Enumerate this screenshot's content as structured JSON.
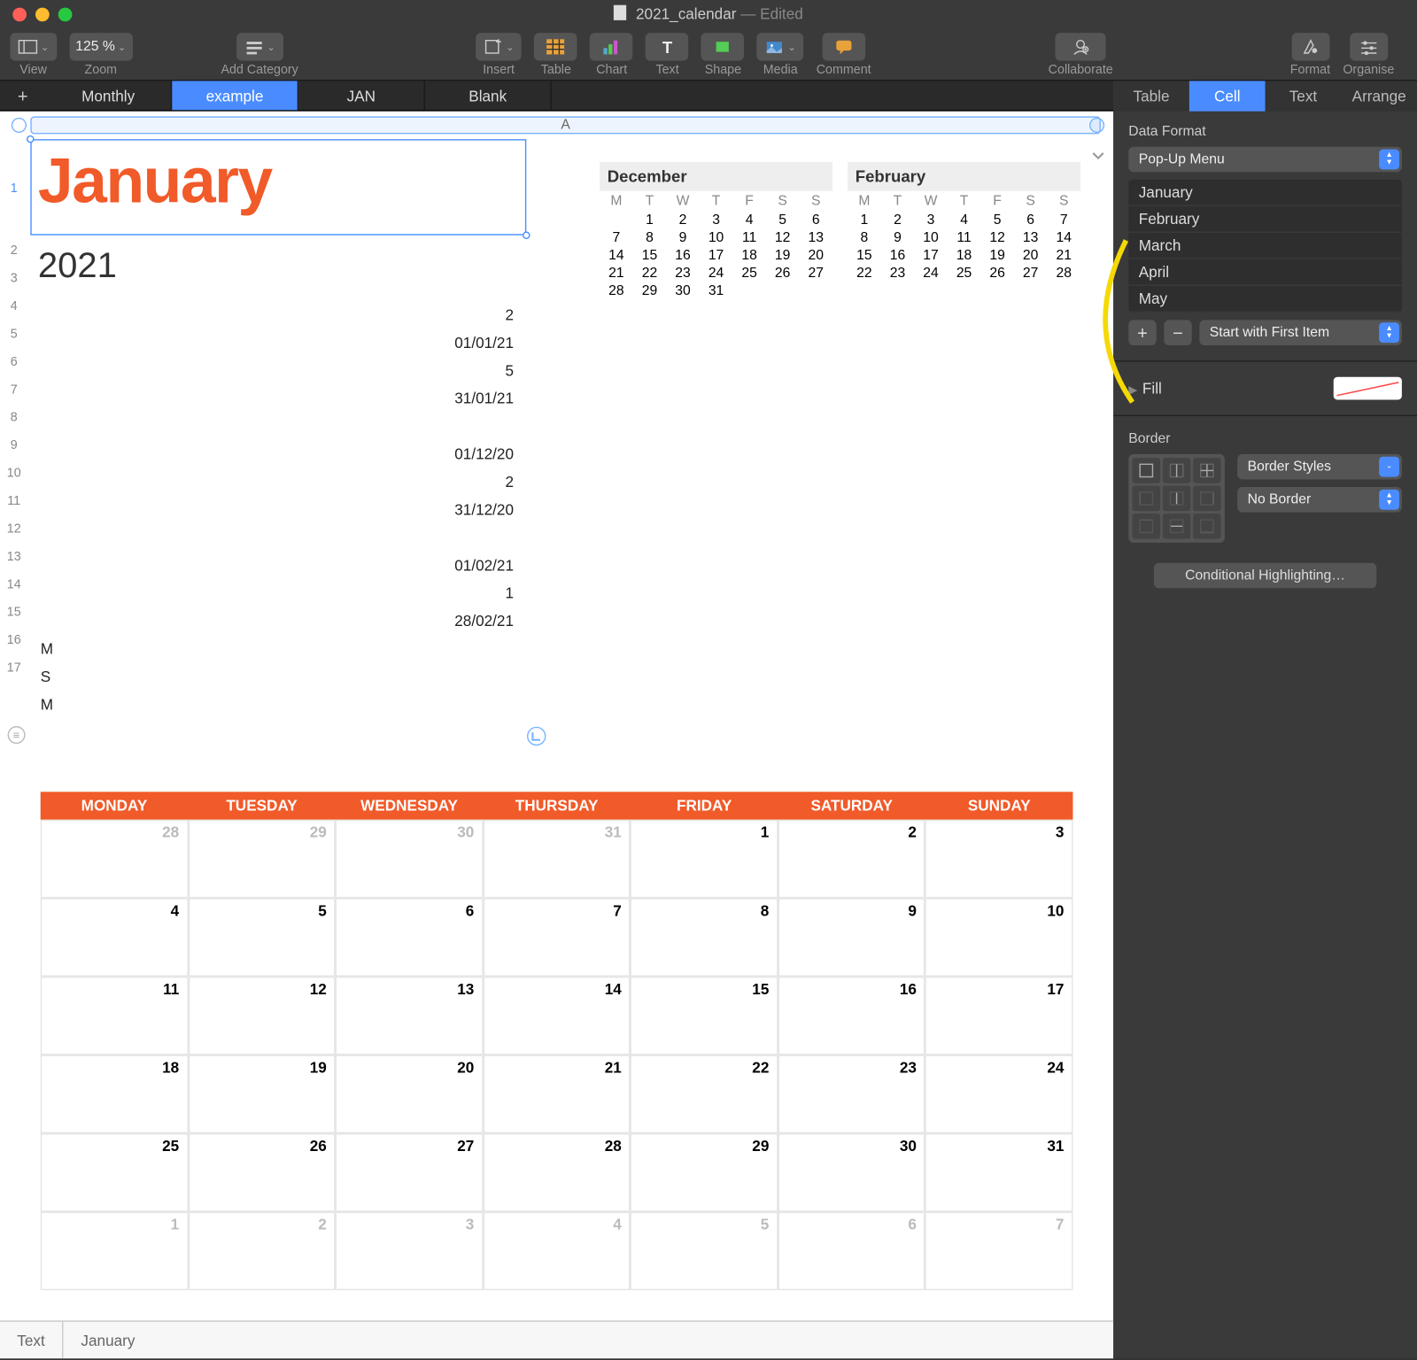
{
  "titlebar": {
    "filename": "2021_calendar",
    "status": "— Edited"
  },
  "toolbar": {
    "view": "View",
    "zoom": "Zoom",
    "zoom_value": "125 %",
    "add_category": "Add Category",
    "insert": "Insert",
    "table": "Table",
    "chart": "Chart",
    "text": "Text",
    "shape": "Shape",
    "media": "Media",
    "comment": "Comment",
    "collaborate": "Collaborate",
    "format": "Format",
    "organise": "Organise"
  },
  "sheets": [
    "Monthly",
    "example",
    "JAN",
    "Blank"
  ],
  "active_sheet": 1,
  "column_letter": "A",
  "row_numbers": [
    "1",
    "2",
    "3",
    "4",
    "5",
    "6",
    "7",
    "8",
    "9",
    "10",
    "11",
    "12",
    "13",
    "14",
    "15",
    "16",
    "17"
  ],
  "cell": {
    "month": "January",
    "year": "2021"
  },
  "data_rows": [
    {
      "t": "r",
      "v": "2"
    },
    {
      "t": "r",
      "v": "01/01/21"
    },
    {
      "t": "r",
      "v": "5"
    },
    {
      "t": "r",
      "v": "31/01/21"
    },
    {
      "t": "r",
      "v": ""
    },
    {
      "t": "r",
      "v": "01/12/20"
    },
    {
      "t": "r",
      "v": "2"
    },
    {
      "t": "r",
      "v": "31/12/20"
    },
    {
      "t": "r",
      "v": ""
    },
    {
      "t": "r",
      "v": "01/02/21"
    },
    {
      "t": "r",
      "v": "1"
    },
    {
      "t": "r",
      "v": "28/02/21"
    },
    {
      "t": "l",
      "v": "M"
    },
    {
      "t": "l",
      "v": "S"
    },
    {
      "t": "l",
      "v": "M"
    }
  ],
  "minicals": [
    {
      "title": "December",
      "days": [
        "M",
        "T",
        "W",
        "T",
        "F",
        "S",
        "S"
      ],
      "rows": [
        [
          "",
          "1",
          "2",
          "3",
          "4",
          "5",
          "6"
        ],
        [
          "7",
          "8",
          "9",
          "10",
          "11",
          "12",
          "13"
        ],
        [
          "14",
          "15",
          "16",
          "17",
          "18",
          "19",
          "20"
        ],
        [
          "21",
          "22",
          "23",
          "24",
          "25",
          "26",
          "27"
        ],
        [
          "28",
          "29",
          "30",
          "31",
          "",
          "",
          ""
        ]
      ]
    },
    {
      "title": "February",
      "days": [
        "M",
        "T",
        "W",
        "T",
        "F",
        "S",
        "S"
      ],
      "rows": [
        [
          "1",
          "2",
          "3",
          "4",
          "5",
          "6",
          "7"
        ],
        [
          "8",
          "9",
          "10",
          "11",
          "12",
          "13",
          "14"
        ],
        [
          "15",
          "16",
          "17",
          "18",
          "19",
          "20",
          "21"
        ],
        [
          "22",
          "23",
          "24",
          "25",
          "26",
          "27",
          "28"
        ],
        [
          "",
          "",
          "",
          "",
          "",
          "",
          ""
        ]
      ]
    }
  ],
  "bigcal": {
    "headers": [
      "MONDAY",
      "TUESDAY",
      "WEDNESDAY",
      "THURSDAY",
      "FRIDAY",
      "SATURDAY",
      "SUNDAY"
    ],
    "cells": [
      {
        "n": "28",
        "p": 1
      },
      {
        "n": "29",
        "p": 1
      },
      {
        "n": "30",
        "p": 1
      },
      {
        "n": "31",
        "p": 1
      },
      {
        "n": "1"
      },
      {
        "n": "2"
      },
      {
        "n": "3"
      },
      {
        "n": "4"
      },
      {
        "n": "5"
      },
      {
        "n": "6"
      },
      {
        "n": "7"
      },
      {
        "n": "8"
      },
      {
        "n": "9"
      },
      {
        "n": "10"
      },
      {
        "n": "11"
      },
      {
        "n": "12"
      },
      {
        "n": "13"
      },
      {
        "n": "14"
      },
      {
        "n": "15"
      },
      {
        "n": "16"
      },
      {
        "n": "17"
      },
      {
        "n": "18"
      },
      {
        "n": "19"
      },
      {
        "n": "20"
      },
      {
        "n": "21"
      },
      {
        "n": "22"
      },
      {
        "n": "23"
      },
      {
        "n": "24"
      },
      {
        "n": "25"
      },
      {
        "n": "26"
      },
      {
        "n": "27"
      },
      {
        "n": "28"
      },
      {
        "n": "29"
      },
      {
        "n": "30"
      },
      {
        "n": "31"
      },
      {
        "n": "1",
        "p": 1
      },
      {
        "n": "2",
        "p": 1
      },
      {
        "n": "3",
        "p": 1
      },
      {
        "n": "4",
        "p": 1
      },
      {
        "n": "5",
        "p": 1
      },
      {
        "n": "6",
        "p": 1
      },
      {
        "n": "7",
        "p": 1
      }
    ]
  },
  "bottombar": {
    "label": "Text",
    "value": "January"
  },
  "inspector": {
    "tabs": [
      "Table",
      "Cell",
      "Text",
      "Arrange"
    ],
    "active_tab": 1,
    "section_label": "Data Format",
    "format_select": "Pop-Up Menu",
    "options": [
      "January",
      "February",
      "March",
      "April",
      "May"
    ],
    "start_option": "Start with First Item",
    "fill_label": "Fill",
    "border_label": "Border",
    "border_styles": "Border Styles",
    "no_border": "No Border",
    "conditional": "Conditional Highlighting…"
  }
}
